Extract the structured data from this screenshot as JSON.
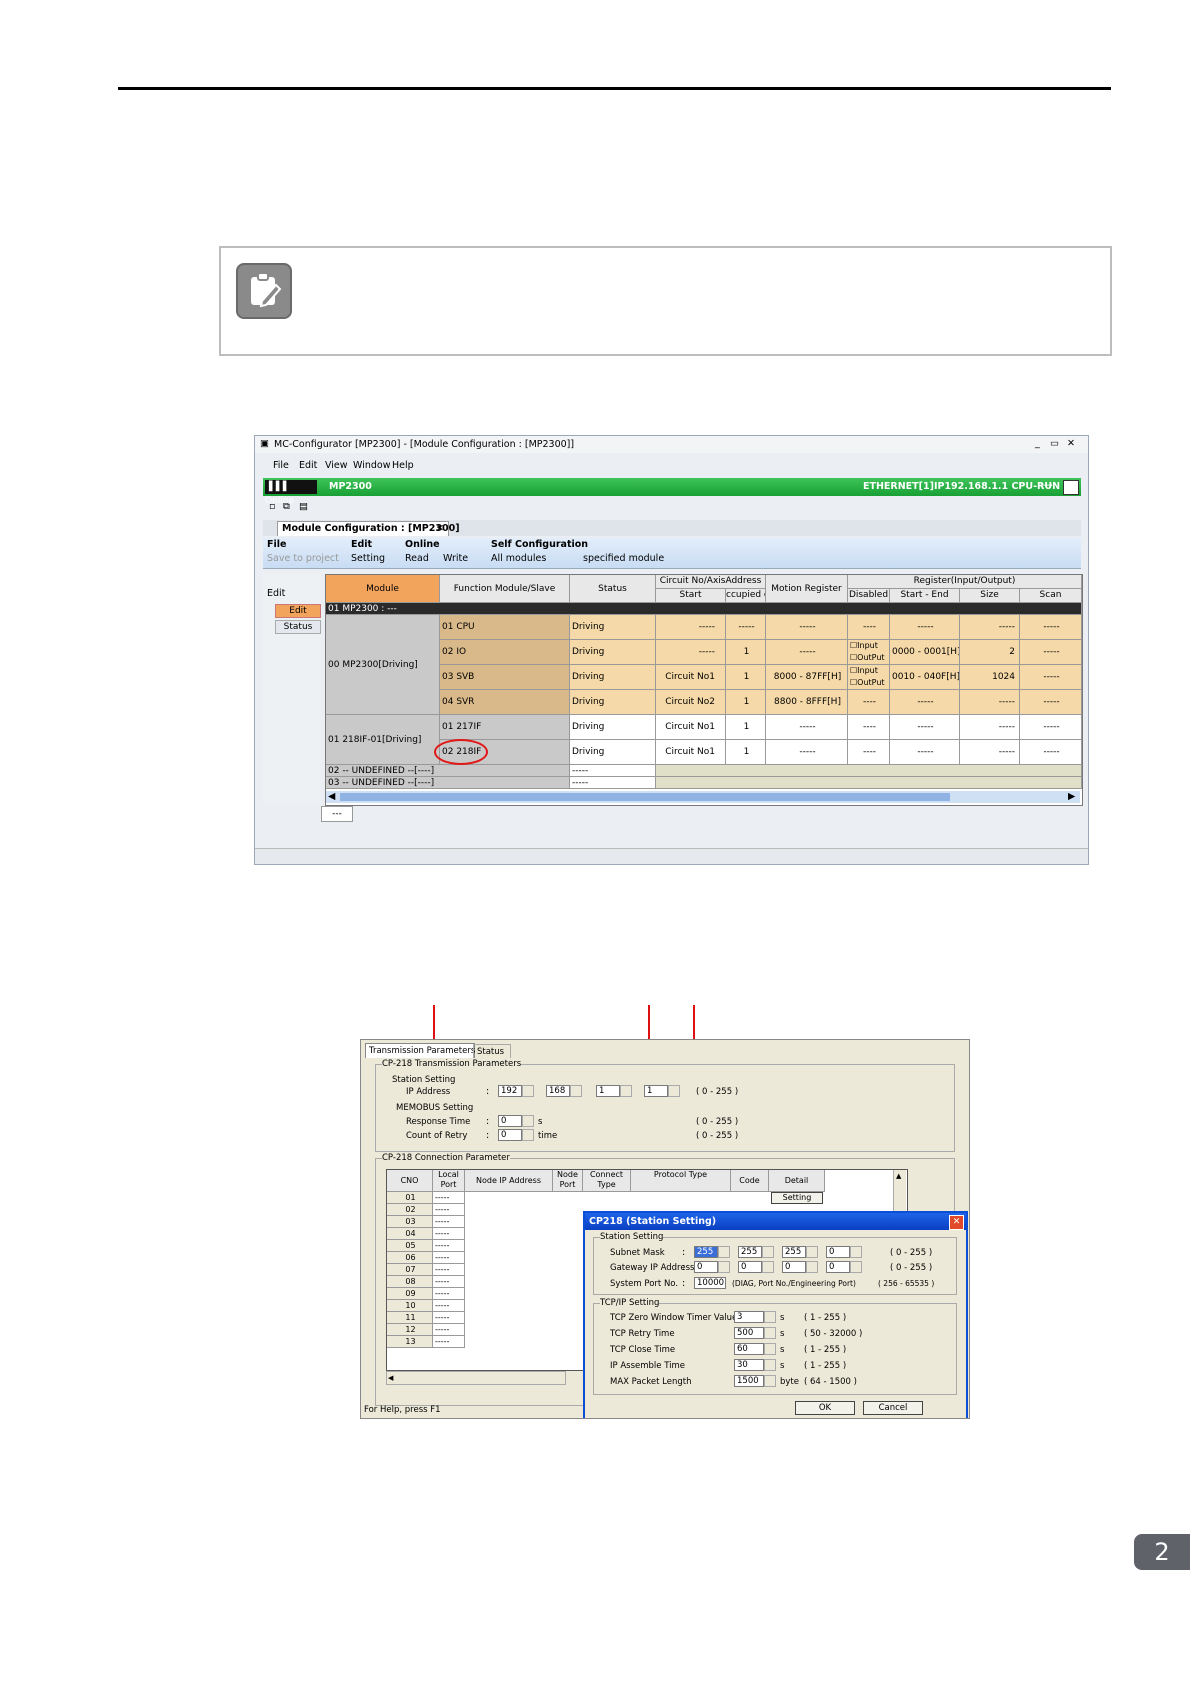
{
  "page": {
    "badge": "2"
  },
  "ss1": {
    "title": "MC-Configurator [MP2300] - [Module Configuration : [MP2300]]",
    "menu": [
      "File",
      "Edit",
      "View",
      "Window",
      "Help"
    ],
    "online_label": "Online",
    "controller": "MP2300",
    "connection": "ETHERNET[1]IP192.168.1.1 CPU-RUN",
    "tab": "Module Configuration : [MP2300]",
    "ribbon": {
      "file_group": "File",
      "save_to_project": "Save to project",
      "edit_group": "Edit",
      "setting": "Setting",
      "online_group": "Online",
      "read": "Read",
      "write": "Write",
      "self_group": "Self Configuration",
      "all_modules": "All modules",
      "specified_module": "specified module"
    },
    "side": {
      "edit_header": "Edit",
      "edit_btn": "Edit",
      "status_btn": "Status"
    },
    "columns": {
      "module": "Module",
      "function": "Function Module/Slave",
      "status": "Status",
      "circuit": "Circuit No/AxisAddress",
      "start": "Start",
      "occupied": "ccupied circu",
      "motion": "Motion Register",
      "register": "Register(Input/Output)",
      "disabled": "Disabled",
      "start_end": "Start - End",
      "size": "Size",
      "scan": "Scan"
    },
    "rack_row": "01  MP2300 : ---",
    "group1": "00  MP2300[Driving]",
    "group2": "01  218IF-01[Driving]",
    "rows": [
      {
        "fn": "01  CPU",
        "status": "Driving",
        "circuit": "-----",
        "occ": "-----",
        "motion": "-----",
        "dis": "----",
        "range": "-----",
        "size": "-----",
        "scan": "-----"
      },
      {
        "fn": "02  IO",
        "status": "Driving",
        "circuit": "-----",
        "occ": "1",
        "motion": "-----",
        "dis_in": "Input",
        "dis_out": "OutPut",
        "range": "0000 - 0001[H]",
        "size": "2",
        "scan": "-----"
      },
      {
        "fn": "03  SVB",
        "status": "Driving",
        "circuit": "Circuit No1",
        "occ": "1",
        "motion": "8000 - 87FF[H]",
        "dis_in": "Input",
        "dis_out": "OutPut",
        "range": "0010 - 040F[H]",
        "size": "1024",
        "scan": "-----"
      },
      {
        "fn": "04  SVR",
        "status": "Driving",
        "circuit": "Circuit No2",
        "occ": "1",
        "motion": "8800 - 8FFF[H]",
        "dis": "----",
        "range": "-----",
        "size": "-----",
        "scan": "-----"
      },
      {
        "fn": "01  217IF",
        "status": "Driving",
        "circuit": "Circuit No1",
        "occ": "1",
        "motion": "-----",
        "dis": "----",
        "range": "-----",
        "size": "-----",
        "scan": "-----"
      },
      {
        "fn": "02  218IF",
        "status": "Driving",
        "circuit": "Circuit No1",
        "occ": "1",
        "motion": "-----",
        "dis": "----",
        "range": "-----",
        "size": "-----",
        "scan": "-----"
      }
    ],
    "undefined1": "02  -- UNDEFINED --[----]",
    "undefined2": "03  -- UNDEFINED --[----]",
    "undefined_status": "-----",
    "bottom_tab": "---"
  },
  "ss2": {
    "tabs": [
      "Transmission Parameters",
      "Status"
    ],
    "group_tx": "CP-218 Transmission Parameters",
    "station_setting": "Station Setting",
    "ip_label": "IP Address",
    "ip": [
      "192",
      "168",
      "1",
      "1"
    ],
    "ip_range": "( 0 - 255 )",
    "memobus": "MEMOBUS Setting",
    "resp_label": "Response Time",
    "resp_value": "0",
    "resp_unit": "s",
    "retry_label": "Count of Retry",
    "retry_value": "0",
    "retry_unit": "time",
    "group_conn": "CP-218 Connection Parameter",
    "conn_cols": {
      "cno": "CNO",
      "local": "Local Port",
      "node_ip": "Node IP Address",
      "node_port": "Node Port",
      "connect": "Connect Type",
      "protocol": "Protocol Type",
      "code": "Code",
      "detail": "Detail"
    },
    "conn_rows": [
      {
        "cno": "01",
        "local": "-----"
      },
      {
        "cno": "02",
        "local": "-----"
      },
      {
        "cno": "03",
        "local": "-----"
      },
      {
        "cno": "04",
        "local": "-----"
      },
      {
        "cno": "05",
        "local": "-----"
      },
      {
        "cno": "06",
        "local": "-----"
      },
      {
        "cno": "07",
        "local": "-----"
      },
      {
        "cno": "08",
        "local": "-----"
      },
      {
        "cno": "09",
        "local": "-----"
      },
      {
        "cno": "10",
        "local": "-----"
      },
      {
        "cno": "11",
        "local": "-----"
      },
      {
        "cno": "12",
        "local": "-----"
      },
      {
        "cno": "13",
        "local": "-----"
      }
    ],
    "detail_btn": "Setting",
    "statusbar": "For Help, press F1",
    "dialog": {
      "title": "CP218 (Station Setting)",
      "station_group": "Station Setting",
      "subnet_label": "Subnet Mask",
      "subnet": [
        "255",
        "255",
        "255",
        "0"
      ],
      "gateway_label": "Gateway IP Address",
      "gateway": [
        "0",
        "0",
        "0",
        "0"
      ],
      "range_255": "( 0 - 255 )",
      "sysport_label": "System Port No.",
      "sysport_value": "10000",
      "sysport_note": "(DIAG, Port No./Engineering Port)",
      "sysport_range": "( 256 - 65535 )",
      "tcp_group": "TCP/IP Setting",
      "zero_label": "TCP Zero Window Timer Value",
      "zero_value": "3",
      "zero_unit": "s",
      "zero_range": "( 1 - 255 )",
      "retry_label": "TCP Retry Time",
      "retry_value": "500",
      "retry_unit": "s",
      "retry_range": "( 50 - 32000 )",
      "close_label": "TCP Close Time",
      "close_value": "60",
      "close_unit": "s",
      "close_range": "( 1 - 255 )",
      "ipasm_label": "IP  Assemble Time",
      "ipasm_value": "30",
      "ipasm_unit": "s",
      "ipasm_range": "( 1 - 255 )",
      "mtu_label": "MAX Packet Length",
      "mtu_value": "1500",
      "mtu_unit": "byte",
      "mtu_range": "( 64 - 1500 )",
      "ok": "OK",
      "cancel": "Cancel"
    }
  }
}
